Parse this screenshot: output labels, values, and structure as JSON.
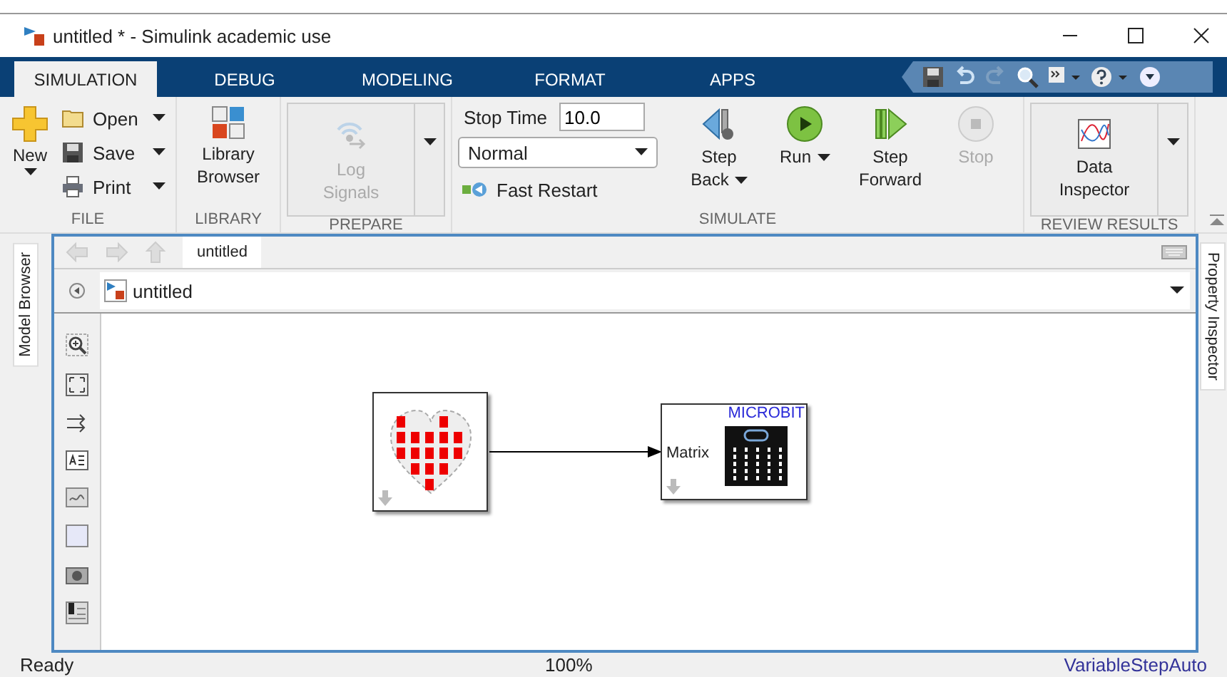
{
  "window": {
    "title": "untitled * - Simulink academic use"
  },
  "tabs": [
    {
      "label": "SIMULATION",
      "selected": true
    },
    {
      "label": "DEBUG",
      "selected": false
    },
    {
      "label": "MODELING",
      "selected": false
    },
    {
      "label": "FORMAT",
      "selected": false
    },
    {
      "label": "APPS",
      "selected": false
    }
  ],
  "groups": [
    {
      "kind": "file",
      "caption": "FILE",
      "new_label": "New",
      "items": [
        {
          "label": "Open"
        },
        {
          "label": "Save"
        },
        {
          "label": "Print"
        }
      ]
    },
    {
      "kind": "library",
      "caption": "LIBRARY",
      "label": "Library Browser"
    },
    {
      "kind": "prepare",
      "caption": "PREPARE",
      "label": "Log Signals",
      "disabled": true
    },
    {
      "kind": "simulate",
      "caption": "SIMULATE",
      "stop_time_label": "Stop Time",
      "stop_time": "10.0",
      "mode": "Normal",
      "fast_restart": "Fast Restart",
      "buttons": [
        {
          "label": "Step Back",
          "disabled": false,
          "menu": true
        },
        {
          "label": "Run",
          "disabled": false,
          "menu": true
        },
        {
          "label": "Step Forward",
          "disabled": false,
          "menu": false
        },
        {
          "label": "Stop",
          "disabled": true,
          "menu": false
        }
      ]
    },
    {
      "kind": "review",
      "caption": "REVIEW RESULTS",
      "label": "Data Inspector"
    }
  ],
  "side_tabs": {
    "left": "Model Browser",
    "right": "Property Inspector"
  },
  "editor": {
    "tab": "untitled",
    "address": "untitled"
  },
  "blocks": {
    "display_title": "MICROBIT",
    "display_port": "Matrix"
  },
  "status_bar": {
    "state": "Ready",
    "zoom": "100%",
    "solver": "VariableStepAuto"
  }
}
